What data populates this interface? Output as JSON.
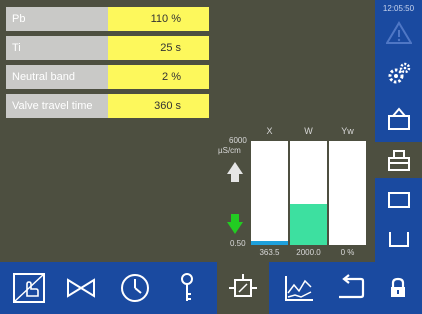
{
  "params": [
    {
      "label": "Pb",
      "value": "110 %"
    },
    {
      "label": "Ti",
      "value": "25 s"
    },
    {
      "label": "Neutral band",
      "value": "2 %"
    },
    {
      "label": "Valve travel time",
      "value": "360 s"
    }
  ],
  "clock": "12:05:50",
  "chart": {
    "ymax": "6000",
    "unit": "µS/cm",
    "ymin": "0.50",
    "headers": [
      "X",
      "W",
      "Yw"
    ],
    "bottom_values": [
      "363.5",
      "2000.0",
      "0 %"
    ]
  },
  "chart_data": {
    "type": "bar",
    "categories": [
      "X",
      "W",
      "Yw"
    ],
    "values": [
      363.5,
      2000.0,
      0
    ],
    "ylim": [
      0.5,
      6000
    ],
    "colors": [
      "#1ea0dc",
      "#3de0a0",
      "#ffffff"
    ]
  },
  "icons": {
    "sidebar": [
      "warning-icon",
      "settings-gears-icon",
      "panel-open-icon",
      "panel-active-icon",
      "window-icon",
      "tray-icon"
    ],
    "bottom": [
      "manual-operation-icon",
      "valve-icon",
      "clock-icon",
      "key-icon",
      "controller-icon",
      "trend-chart-icon",
      "return-icon",
      "lock-icon"
    ]
  }
}
